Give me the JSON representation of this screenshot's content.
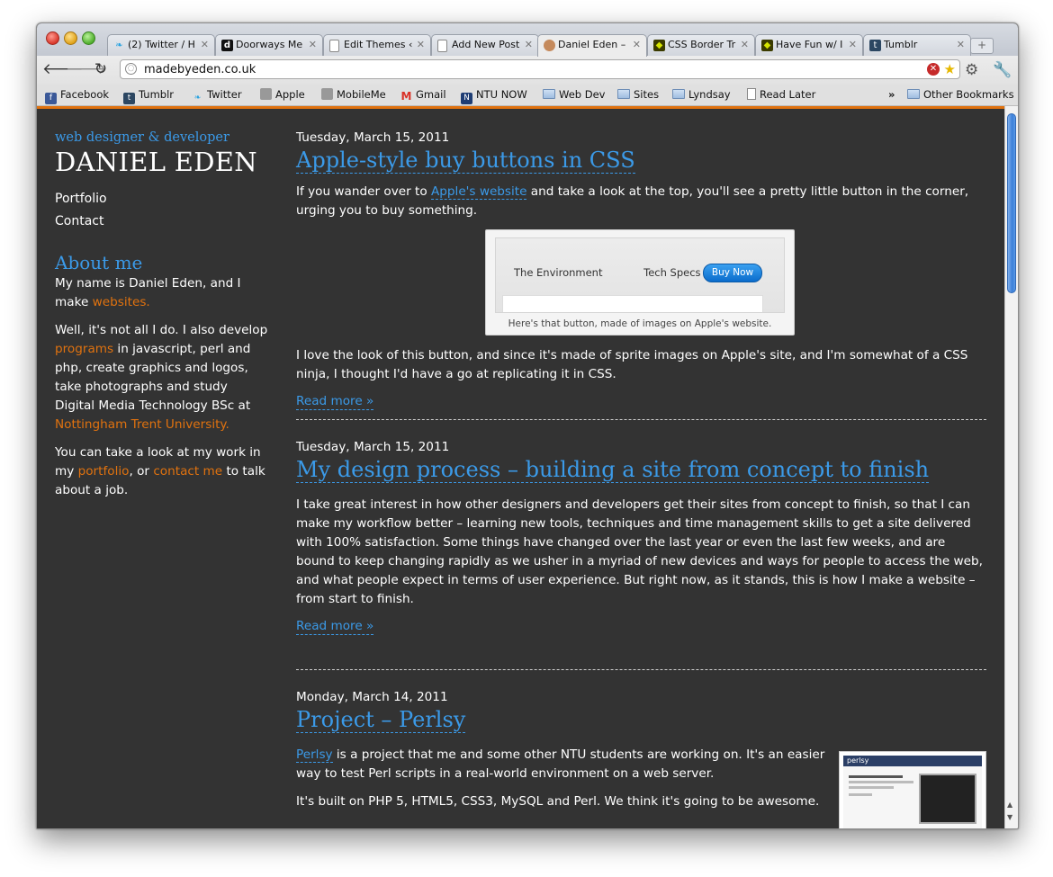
{
  "browser": {
    "tabs": [
      {
        "label": "(2) Twitter / H",
        "icon": "twitter-bird-icon",
        "active": false
      },
      {
        "label": "Doorways Me",
        "icon": "dm-logo-icon",
        "active": false
      },
      {
        "label": "Edit Themes ‹",
        "icon": "page-icon",
        "active": false
      },
      {
        "label": "Add New Post",
        "icon": "page-icon",
        "active": false
      },
      {
        "label": "Daniel Eden –",
        "icon": "avatar-icon",
        "active": true
      },
      {
        "label": "CSS Border Tr",
        "icon": "invader-icon",
        "active": false
      },
      {
        "label": "Have Fun w/ I",
        "icon": "invader-icon",
        "active": false
      },
      {
        "label": "Tumblr",
        "icon": "tumblr-icon",
        "active": false
      }
    ],
    "url": "madebyeden.co.uk",
    "bookmarks": [
      {
        "label": "Facebook",
        "icon": "facebook-icon"
      },
      {
        "label": "Tumblr",
        "icon": "tumblr-icon"
      },
      {
        "label": "Twitter",
        "icon": "twitter-bird-icon"
      },
      {
        "label": "Apple",
        "icon": "apple-icon"
      },
      {
        "label": "MobileMe",
        "icon": "apple-icon"
      },
      {
        "label": "Gmail",
        "icon": "gmail-icon"
      },
      {
        "label": "NTU NOW",
        "icon": "ntu-icon"
      },
      {
        "label": "Web Dev",
        "icon": "folder-icon"
      },
      {
        "label": "Sites",
        "icon": "folder-icon"
      },
      {
        "label": "Lyndsay",
        "icon": "folder-icon"
      },
      {
        "label": "Read Later",
        "icon": "page-icon"
      }
    ],
    "overflow_chevron": "»",
    "other_bookmarks": "Other Bookmarks"
  },
  "site": {
    "tagline": "web designer & developer",
    "name": "DANIEL EDEN",
    "nav": [
      "Portfolio",
      "Contact"
    ],
    "about_heading": "About me",
    "about_p1_text": "My name is Daniel Eden, and I make ",
    "about_p1_link": "websites.",
    "about_p2_a": "Well, it's not all I do. I also develop ",
    "about_p2_link1": "programs",
    "about_p2_b": " in javascript, perl and php, create graphics and logos, take photographs and study Digital Media Technology BSc at ",
    "about_p2_link2": "Nottingham Trent University.",
    "about_p3_a": "You can take a look at my work in my ",
    "about_p3_link1": "portfolio",
    "about_p3_b": ", or ",
    "about_p3_link2": "contact me",
    "about_p3_c": " to talk about a job."
  },
  "posts": [
    {
      "date": "Tuesday, March 15, 2011",
      "title": "Apple-style buy buttons in CSS",
      "intro_a": "If you wander over to ",
      "intro_link": "Apple's website",
      "intro_b": " and take a look at the top, you'll see a pretty little button in the corner, urging you to buy something.",
      "figure": {
        "tab1": "The Environment",
        "tab2": "Tech Specs",
        "button": "Buy Now",
        "caption": "Here's that button, made of images on Apple's website."
      },
      "body": "I love the look of this button, and since it's made of sprite images on Apple's site, and I'm somewhat of a CSS ninja, I thought I'd have a go at replicating it in CSS.",
      "read_more": "Read more »"
    },
    {
      "date": "Tuesday, March 15, 2011",
      "title": "My design process – building a site from concept to finish",
      "body": "I take great interest in how other designers and developers get their sites from concept to finish, so that I can make my workflow better – learning new tools, techniques and time management skills to get a site delivered with 100% satisfaction. Some things have changed over the last year or even the last few weeks, and are bound to keep changing rapidly as we usher in a myriad of new devices and ways for people to access the web, and what people expect in terms of user experience. But right now, as it stands, this is how I make a website – from start to finish.",
      "read_more": "Read more »"
    },
    {
      "date": "Monday, March 14, 2011",
      "title": "Project – Perlsy",
      "intro_link": "Perlsy",
      "intro_b": " is a project that me and some other NTU students are working on. It's an easier way to test Perl scripts in a real-world environment on a web server.",
      "body": "It's built on PHP 5, HTML5, CSS3, MySQL and Perl. We think it's going to be awesome.",
      "thumb_logo": "perlsy"
    }
  ],
  "colors": {
    "accent_blue": "#3b9ae8",
    "accent_orange": "#e0720f",
    "page_bg": "#333333"
  }
}
